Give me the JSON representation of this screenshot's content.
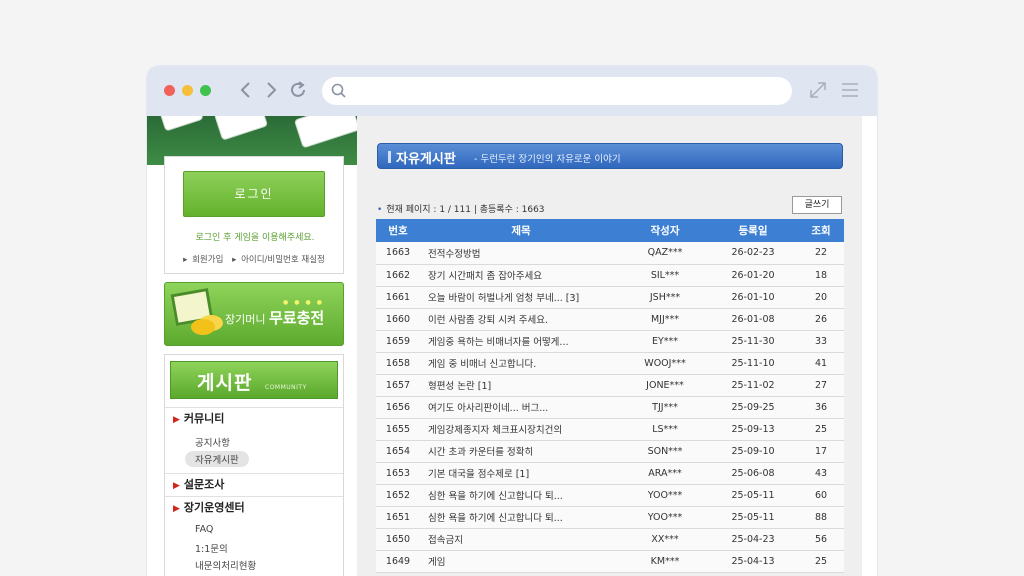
{
  "login": {
    "button": "로그인",
    "message": "로그인 후 게임을 이용해주세요.",
    "links": [
      "회원가입",
      "아이디/비밀번호 재실정"
    ]
  },
  "charge_banner": {
    "text_small": "장기머니",
    "text_big": "무료충전"
  },
  "board_menu": {
    "title": "게시판",
    "title_small": "COMMUNITY",
    "sections": [
      {
        "label": "커뮤니티",
        "items": [
          "공지사항",
          "자유게시판"
        ]
      },
      {
        "label": "설문조사",
        "items": []
      },
      {
        "label": "장기운영센터",
        "items": [
          "FAQ",
          "1:1문의",
          "내문의처리현황"
        ]
      }
    ]
  },
  "board": {
    "title": "자유게시판",
    "subtitle": "- 두런두런 장기인의 자유로운 이야기",
    "page_info": "현재 페이지 : 1 / 111 | 총등록수 : 1663",
    "write_button": "글쓰기",
    "columns": [
      "번호",
      "제목",
      "작성자",
      "등록일",
      "조회"
    ],
    "rows": [
      {
        "no": "1663",
        "subject": "전적수정방법",
        "author": "QAZ***",
        "date": "26-02-23",
        "views": "22"
      },
      {
        "no": "1662",
        "subject": "장기 시간패치 좀 잡아주세요",
        "author": "SIL***",
        "date": "26-01-20",
        "views": "18"
      },
      {
        "no": "1661",
        "subject": "오늘 바람이 허벌나게 엄청 부네... [3]",
        "author": "JSH***",
        "date": "26-01-10",
        "views": "20"
      },
      {
        "no": "1660",
        "subject": "이런 사람좀 강퇴 시켜 주세요.",
        "author": "MJJ***",
        "date": "26-01-08",
        "views": "26"
      },
      {
        "no": "1659",
        "subject": "게임중 욕하는 비매너자를 어떻게...",
        "author": "EY***",
        "date": "25-11-30",
        "views": "33"
      },
      {
        "no": "1658",
        "subject": "게임 중 비매너 신고합니다.",
        "author": "WOOJ***",
        "date": "25-11-10",
        "views": "41"
      },
      {
        "no": "1657",
        "subject": "형편성 논란 [1]",
        "author": "JONE***",
        "date": "25-11-02",
        "views": "27"
      },
      {
        "no": "1656",
        "subject": "여기도 아사리판이네... 버그...",
        "author": "TJJ***",
        "date": "25-09-25",
        "views": "36"
      },
      {
        "no": "1655",
        "subject": "게임강제종지자 체크표시장치건의",
        "author": "LS***",
        "date": "25-09-13",
        "views": "25"
      },
      {
        "no": "1654",
        "subject": "시간 초과 카운터를 정확히",
        "author": "SON***",
        "date": "25-09-10",
        "views": "17"
      },
      {
        "no": "1653",
        "subject": "기본 대국을 점수제로 [1]",
        "author": "ARA***",
        "date": "25-06-08",
        "views": "43"
      },
      {
        "no": "1652",
        "subject": "심한 욕을 하기에 신고합니다 퇴...",
        "author": "YOO***",
        "date": "25-05-11",
        "views": "60"
      },
      {
        "no": "1651",
        "subject": "심한 욕을 하기에 신고합니다 퇴...",
        "author": "YOO***",
        "date": "25-05-11",
        "views": "88"
      },
      {
        "no": "1650",
        "subject": "접속금지",
        "author": "XX***",
        "date": "25-04-23",
        "views": "56"
      },
      {
        "no": "1649",
        "subject": "게임",
        "author": "KM***",
        "date": "25-04-13",
        "views": "25"
      }
    ]
  },
  "icons": {
    "back": "chevron-left-icon",
    "forward": "chevron-right-icon",
    "reload": "reload-icon",
    "search": "search-icon",
    "expand": "expand-icon",
    "menu": "hamburger-menu-icon"
  },
  "colors": {
    "accent_green": "#64b22c",
    "accent_blue": "#3c7fd3",
    "alert_red": "#d2251c"
  }
}
